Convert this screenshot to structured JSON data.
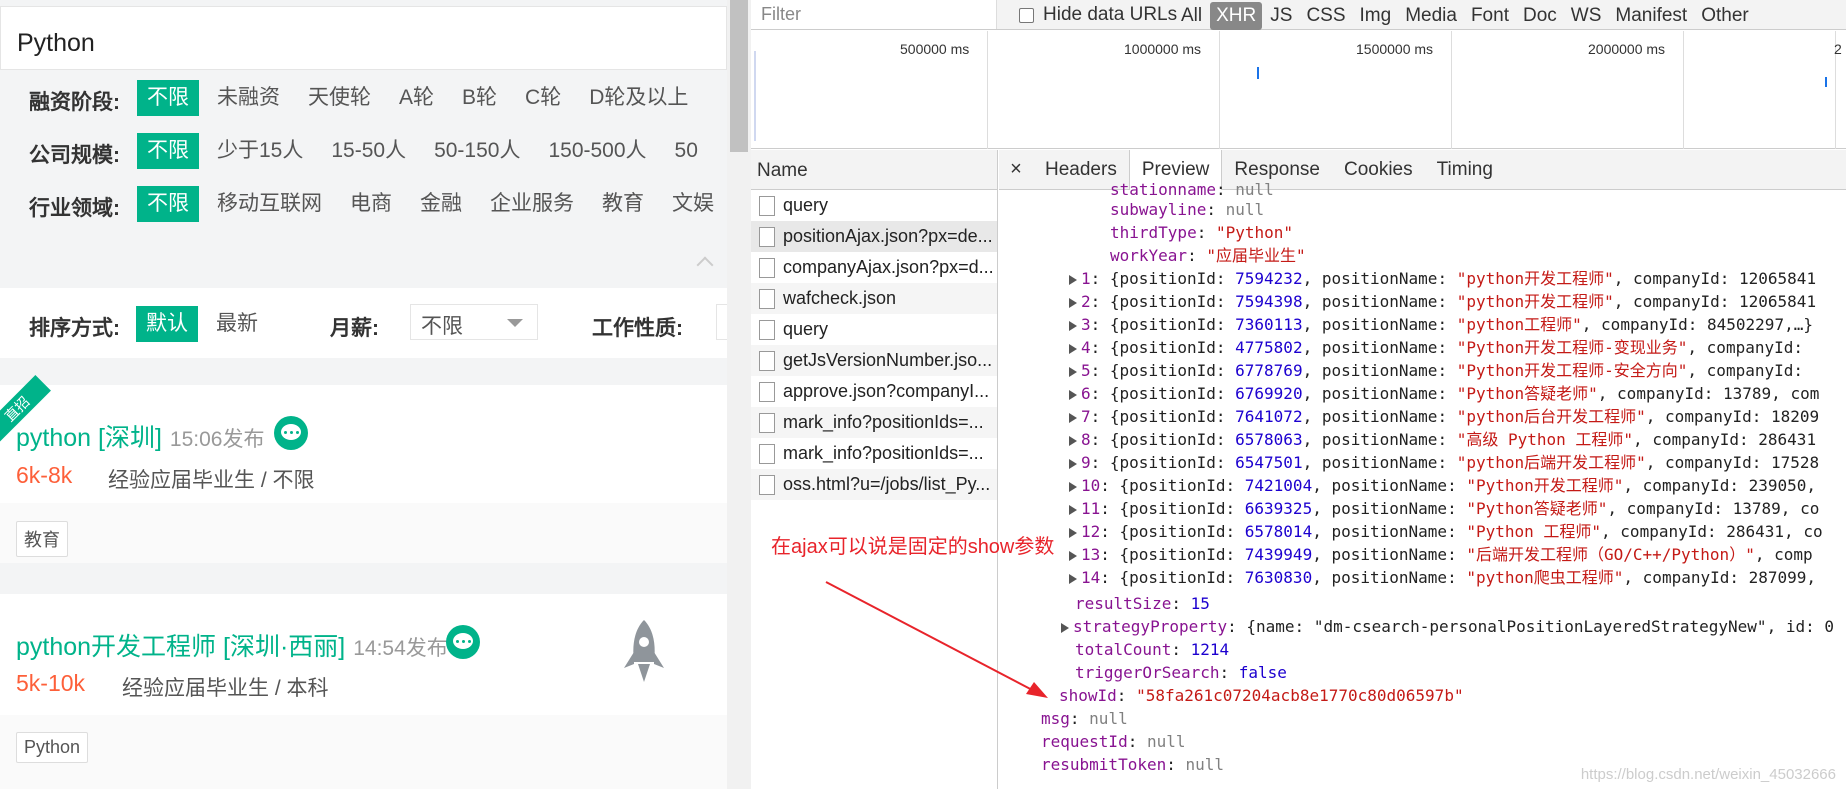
{
  "left": {
    "search_value": "Python",
    "filters": [
      {
        "label": "融资阶段:",
        "options": [
          "不限",
          "未融资",
          "天使轮",
          "A轮",
          "B轮",
          "C轮",
          "D轮及以上"
        ]
      },
      {
        "label": "公司规模:",
        "options": [
          "不限",
          "少于15人",
          "15-50人",
          "50-150人",
          "150-500人",
          "50"
        ]
      },
      {
        "label": "行业领域:",
        "options": [
          "不限",
          "移动互联网",
          "电商",
          "金融",
          "企业服务",
          "教育",
          "文娱"
        ]
      }
    ],
    "sort": {
      "label": "排序方式:",
      "options": [
        "默认",
        "最新"
      ],
      "salary_label": "月薪:",
      "salary_value": "不限",
      "worktype_label": "工作性质:"
    },
    "ribbon": "直招",
    "jobs": [
      {
        "title": "python [深圳]",
        "time": "15:06发布",
        "salary": "6k-8k",
        "requirement": "经验应届毕业生 / 不限",
        "tag": "教育"
      },
      {
        "title": "python开发工程师 [深圳·西丽]",
        "time": "14:54发布",
        "salary": "5k-10k",
        "requirement": "经验应届毕业生 / 本科",
        "tag": "Python"
      }
    ],
    "accent": "#00b38a",
    "salary_color": "#fd5f39"
  },
  "devtools": {
    "filter_placeholder": "Filter",
    "hide_data_urls": "Hide data URLs",
    "types": [
      "All",
      "XHR",
      "JS",
      "CSS",
      "Img",
      "Media",
      "Font",
      "Doc",
      "WS",
      "Manifest",
      "Other"
    ],
    "selected_type": "XHR",
    "timeline_ticks": [
      "500000 ms",
      "1000000 ms",
      "1500000 ms",
      "2000000 ms",
      "2"
    ],
    "name_header": "Name",
    "requests": [
      "query",
      "positionAjax.json?px=de...",
      "companyAjax.json?px=d...",
      "wafcheck.json",
      "query",
      "getJsVersionNumber.jso...",
      "approve.json?companyI...",
      "mark_info?positionIds=...",
      "mark_info?positionIds=...",
      "oss.html?u=/jobs/list_Py..."
    ],
    "selected_request": 1,
    "detail_tabs": [
      "Headers",
      "Preview",
      "Response",
      "Cookies",
      "Timing"
    ],
    "selected_tab": "Preview",
    "json": {
      "stationname_partial": "stationname",
      "subwayline_key": "subwayline",
      "thirdType_key": "thirdType",
      "thirdType_val": "\"Python\"",
      "workYear_key": "workYear",
      "workYear_val": "\"应届毕业生\"",
      "null": "null",
      "results": [
        {
          "idx": "1",
          "id": "7594232",
          "name": "\"python开发工程师\"",
          "rest": "companyId: 12065841"
        },
        {
          "idx": "2",
          "id": "7594398",
          "name": "\"python开发工程师\"",
          "rest": "companyId: 12065841"
        },
        {
          "idx": "3",
          "id": "7360113",
          "name": "\"python工程师\"",
          "rest": "companyId: 84502297,…}"
        },
        {
          "idx": "4",
          "id": "4775802",
          "name": "\"Python开发工程师-变现业务\"",
          "rest": "companyId:"
        },
        {
          "idx": "5",
          "id": "6778769",
          "name": "\"Python开发工程师-安全方向\"",
          "rest": "companyId:"
        },
        {
          "idx": "6",
          "id": "6769920",
          "name": "\"Python答疑老师\"",
          "rest": "companyId: 13789, com"
        },
        {
          "idx": "7",
          "id": "7641072",
          "name": "\"python后台开发工程师\"",
          "rest": "companyId: 18209"
        },
        {
          "idx": "8",
          "id": "6578063",
          "name": "\"高级 Python 工程师\"",
          "rest": "companyId: 286431"
        },
        {
          "idx": "9",
          "id": "6547501",
          "name": "\"python后端开发工程师\"",
          "rest": "companyId: 17528"
        },
        {
          "idx": "10",
          "id": "7421004",
          "name": "\"Python开发工程师\"",
          "rest": "companyId: 239050,"
        },
        {
          "idx": "11",
          "id": "6639325",
          "name": "\"Python答疑老师\"",
          "rest": "companyId: 13789, co"
        },
        {
          "idx": "12",
          "id": "6578014",
          "name": "\"Python 工程师\"",
          "rest": "companyId: 286431, co"
        },
        {
          "idx": "13",
          "id": "7439949",
          "name": "\"后端开发工程师（GO/C++/Python）\"",
          "rest": "comp"
        },
        {
          "idx": "14",
          "id": "7630830",
          "name": "\"python爬虫工程师\"",
          "rest": "companyId: 287099,"
        }
      ],
      "resultSize_key": "resultSize",
      "resultSize_val": "15",
      "strategyProperty_key": "strategyProperty",
      "strategyProperty_val": "{name: \"dm-csearch-personalPositionLayeredStrategyNew\", id: 0",
      "totalCount_key": "totalCount",
      "totalCount_val": "1214",
      "triggerOrSearch_key": "triggerOrSearch",
      "triggerOrSearch_val": "false",
      "showId_key": "showId",
      "showId_val": "\"58fa261c07204acb8e1770c80d06597b\"",
      "msg_key": "msg",
      "requestId_key": "requestId",
      "resubmitToken_key": "resubmitToken"
    }
  },
  "annotation": "在ajax可以说是固定的show参数",
  "watermark": "https://blog.csdn.net/weixin_45032666",
  "annotation_color": "#e8242b"
}
